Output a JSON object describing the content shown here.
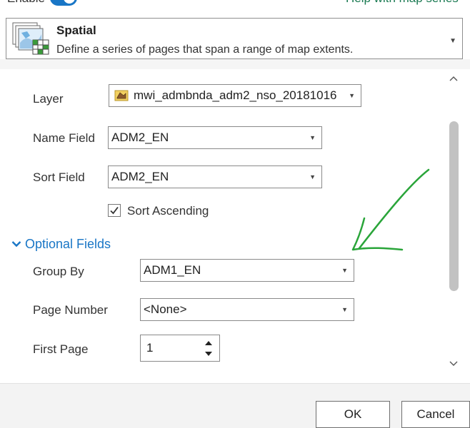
{
  "header": {
    "enable_label": "Enable",
    "help_link": "Help with map series"
  },
  "type_selector": {
    "title": "Spatial",
    "description": "Define a series of pages that span a range of map extents."
  },
  "fields": {
    "layer": {
      "label": "Layer",
      "value": "mwi_admbnda_adm2_nso_20181016"
    },
    "name_field": {
      "label": "Name Field",
      "value": "ADM2_EN"
    },
    "sort_field": {
      "label": "Sort Field",
      "value": "ADM2_EN"
    },
    "sort_ascending": {
      "label": "Sort Ascending",
      "checked": true
    }
  },
  "optional": {
    "title": "Optional Fields",
    "group_by": {
      "label": "Group By",
      "value": "ADM1_EN"
    },
    "page_number": {
      "label": "Page Number",
      "value": "<None>"
    },
    "first_page": {
      "label": "First Page",
      "value": "1"
    }
  },
  "buttons": {
    "ok": "OK",
    "cancel": "Cancel"
  },
  "colors": {
    "accent": "#1976c6",
    "help_link": "#1a7a52",
    "annotation_arrow": "#2aa53a"
  },
  "icons": {
    "type_icon": "spatial-map-series-icon",
    "layer_icon": "polygon-layer-icon",
    "checkbox": "checkmark-icon",
    "section": "chevron-down-icon",
    "scroll_up": "chevron-up-icon",
    "scroll_down": "chevron-down-icon",
    "annotation": "hand-drawn-arrow"
  }
}
